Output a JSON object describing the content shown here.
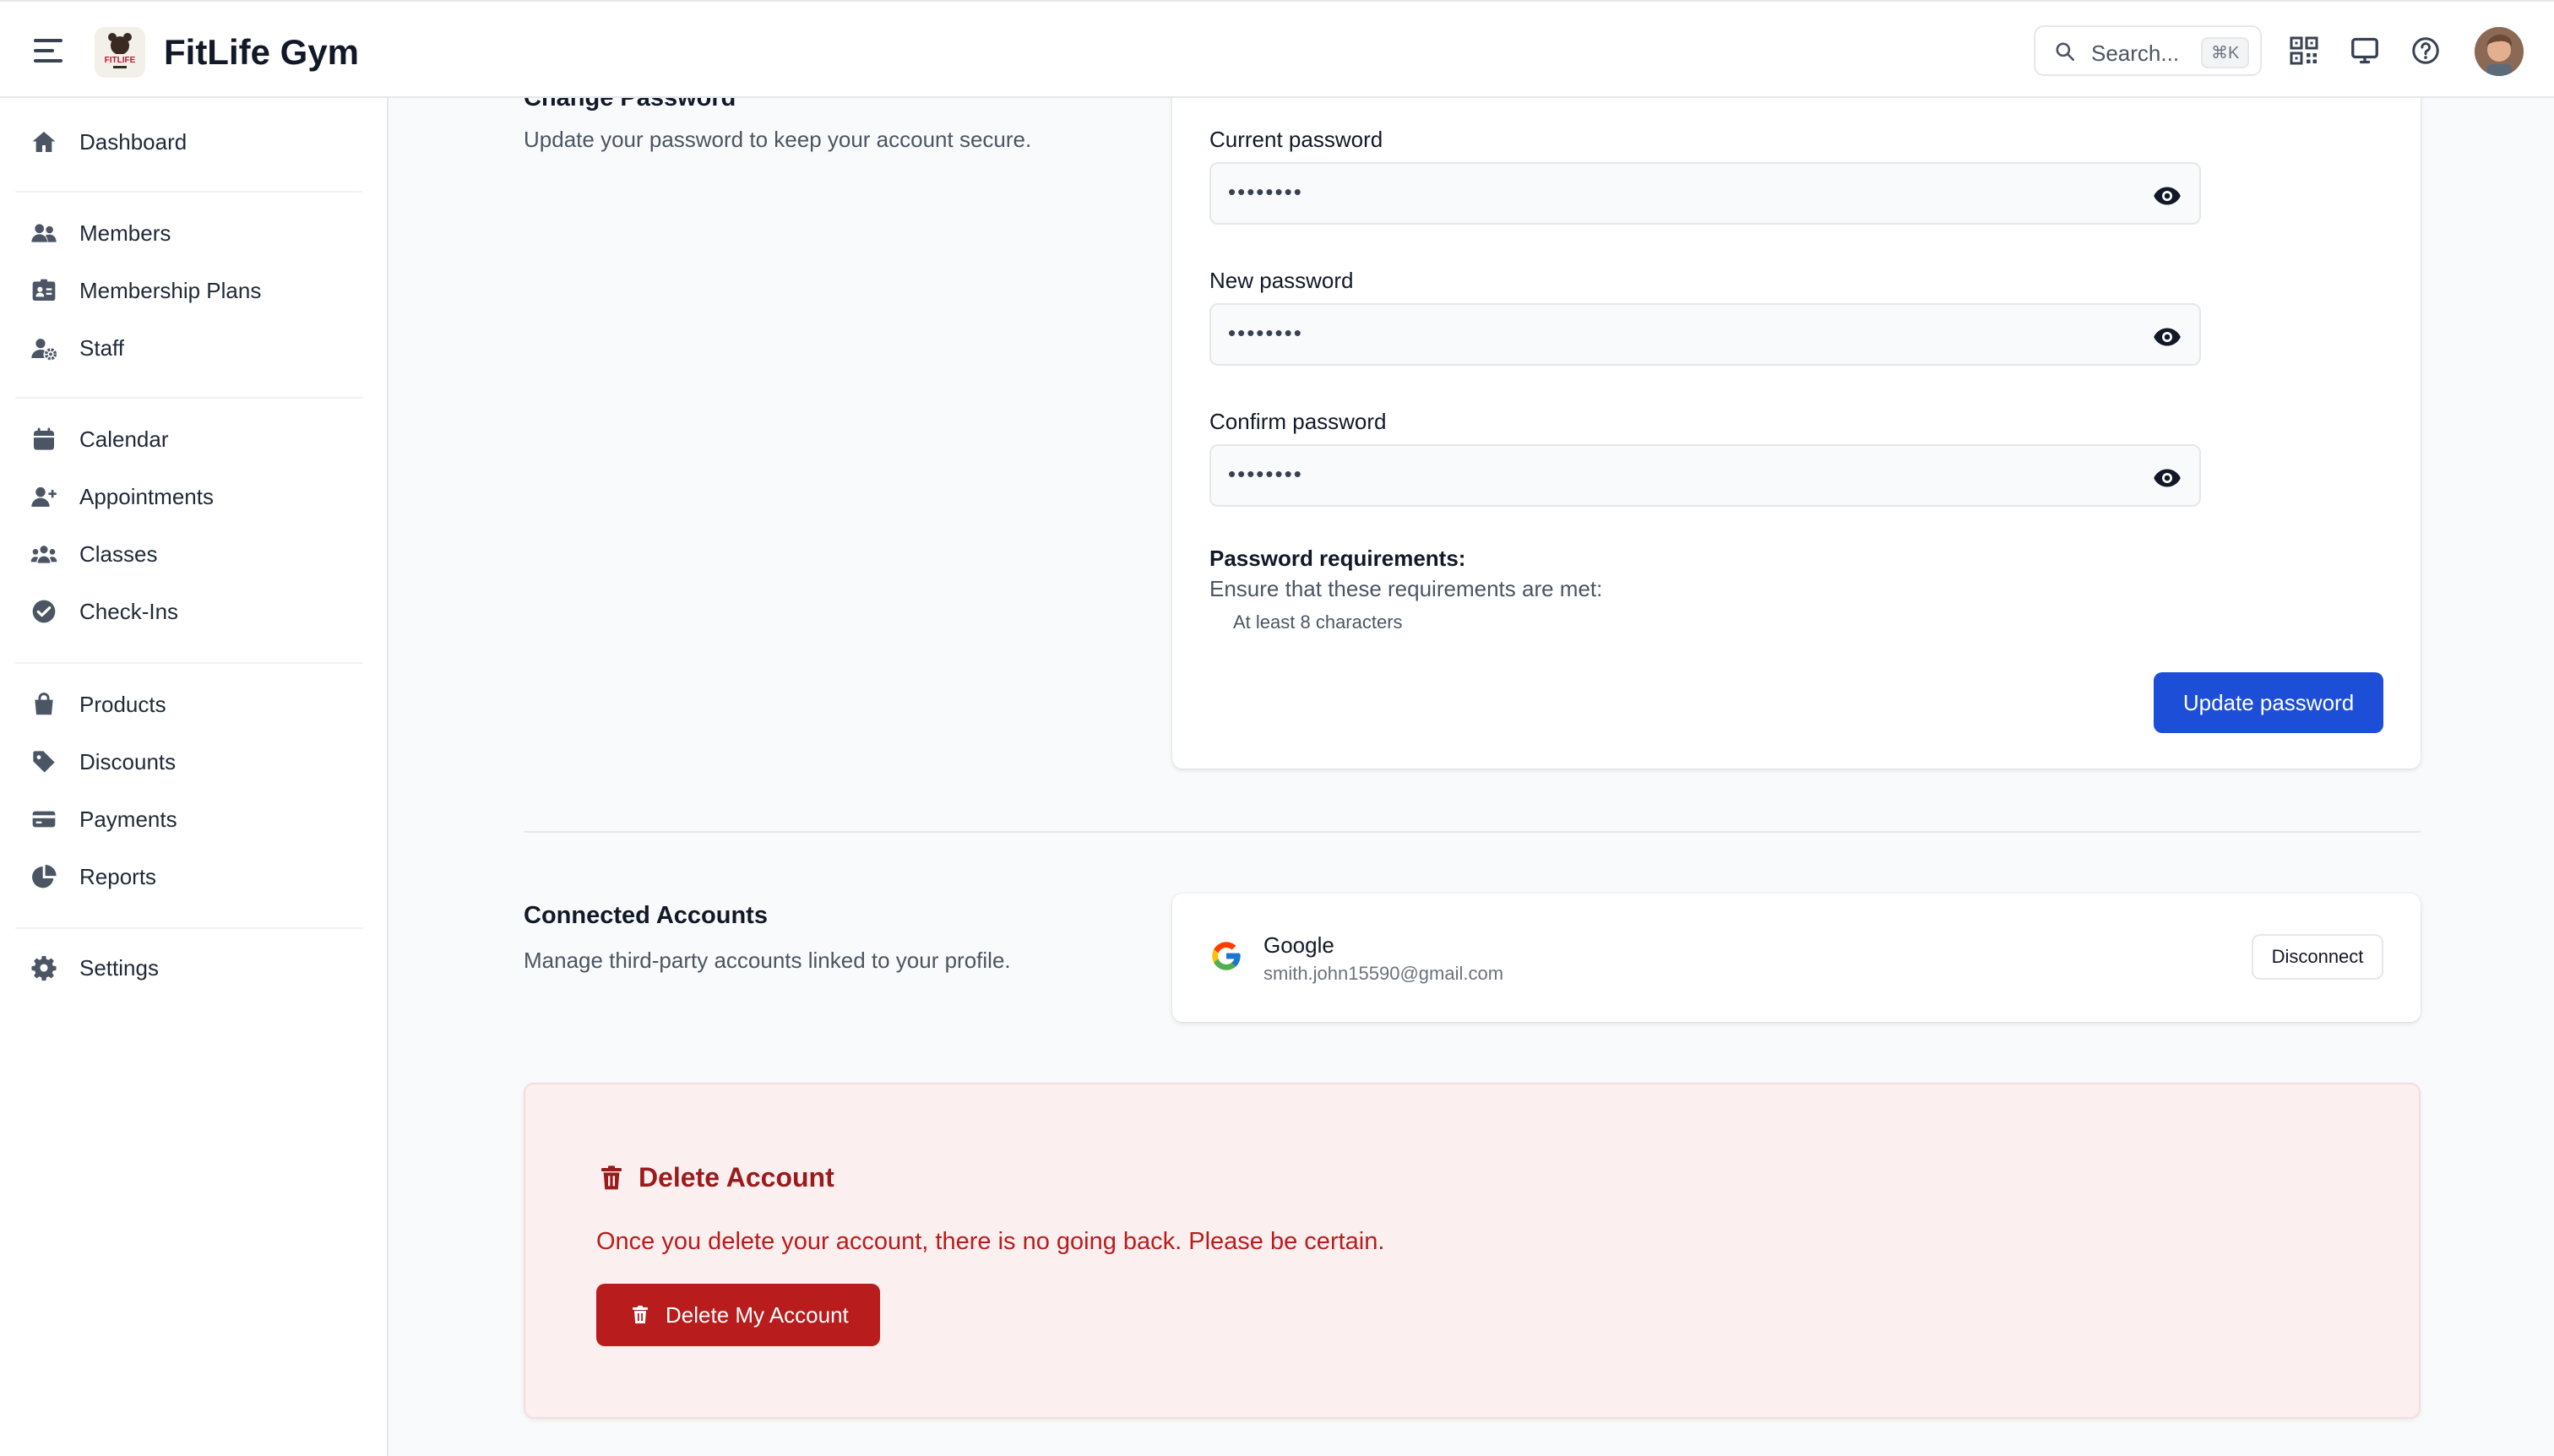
{
  "header": {
    "brand": "FitLife Gym",
    "logo_text": "FITLIFE",
    "search_placeholder": "Search...",
    "search_shortcut": "⌘K"
  },
  "sidebar": {
    "items": [
      {
        "label": "Dashboard",
        "icon": "home-icon"
      },
      {
        "label": "Members",
        "icon": "users-icon"
      },
      {
        "label": "Membership Plans",
        "icon": "id-card-icon"
      },
      {
        "label": "Staff",
        "icon": "user-gear-icon"
      },
      {
        "label": "Calendar",
        "icon": "calendar-icon"
      },
      {
        "label": "Appointments",
        "icon": "user-plus-icon"
      },
      {
        "label": "Classes",
        "icon": "people-group-icon"
      },
      {
        "label": "Check-Ins",
        "icon": "check-circle-icon"
      },
      {
        "label": "Products",
        "icon": "shopping-bag-icon"
      },
      {
        "label": "Discounts",
        "icon": "tag-icon"
      },
      {
        "label": "Payments",
        "icon": "credit-card-icon"
      },
      {
        "label": "Reports",
        "icon": "pie-chart-icon"
      },
      {
        "label": "Settings",
        "icon": "gear-icon"
      }
    ]
  },
  "change_password": {
    "title": "Change Password",
    "description": "Update your password to keep your account secure.",
    "current_label": "Current password",
    "current_value": "••••••••",
    "new_label": "New password",
    "new_value": "••••••••",
    "confirm_label": "Confirm password",
    "confirm_value": "••••••••",
    "requirements_title": "Password requirements:",
    "requirements_desc": "Ensure that these requirements are met:",
    "requirements": [
      "At least 8 characters"
    ],
    "submit_label": "Update password"
  },
  "connected_accounts": {
    "title": "Connected Accounts",
    "description": "Manage third-party accounts linked to your profile.",
    "accounts": [
      {
        "provider": "Google",
        "email": "smith.john15590@gmail.com",
        "action": "Disconnect"
      }
    ]
  },
  "delete_account": {
    "title": "Delete Account",
    "warning": "Once you delete your account, there is no going back. Please be certain.",
    "button_label": "Delete My Account"
  },
  "colors": {
    "primary": "#1d4ed8",
    "danger": "#b91c1c",
    "danger_bg": "#fcefef",
    "sidebar_icon": "#4b5563"
  }
}
